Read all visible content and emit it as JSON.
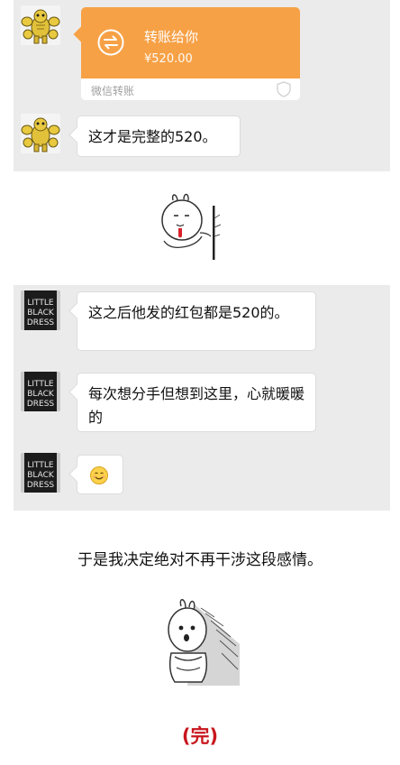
{
  "chat1": {
    "transfer": {
      "title": "转账给你",
      "amount": "¥520.00",
      "source": "微信转账"
    },
    "message": "这才是完整的520。"
  },
  "chat2": {
    "messages": [
      "这之后他发的红包都是520的。",
      "每次想分手但想到这里，心就暖暖的"
    ],
    "avatar_shirt_text": [
      "LITTLE",
      "BLACK",
      "DRESS"
    ]
  },
  "caption": "于是我决定绝对不再干涉这段感情。",
  "end": "(完)",
  "icons": {
    "transfer": "transfer-arrows-icon",
    "shield": "shield-icon",
    "emoji": "smiley-emoji-icon",
    "sticker1": "rabbit-peek-sticker",
    "sticker2": "rabbit-sit-sticker"
  },
  "colors": {
    "transfer_orange": "#f7a146",
    "panel_gray": "#ebebeb",
    "end_red": "#c8161d"
  }
}
